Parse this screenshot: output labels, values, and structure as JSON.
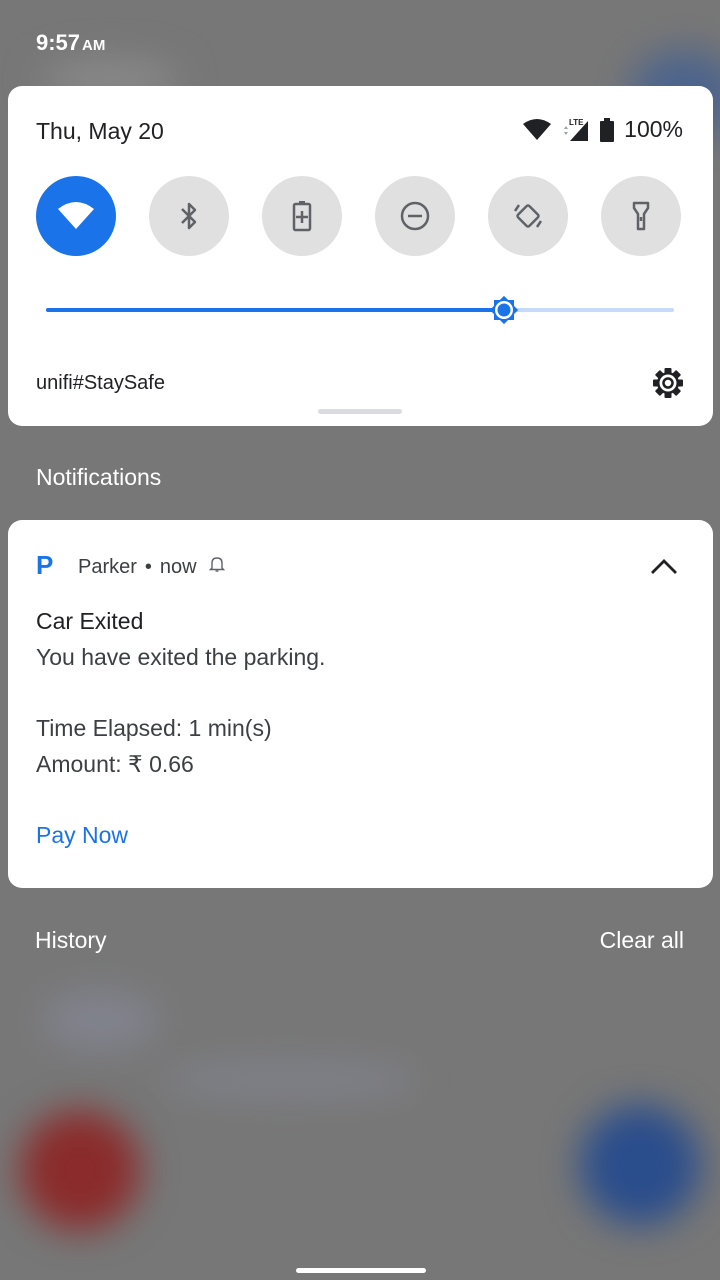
{
  "status_bar": {
    "time": "9:57",
    "ampm": "AM"
  },
  "quick_settings": {
    "date": "Thu, May 20",
    "battery_text": "100%",
    "tiles": [
      {
        "name": "wifi",
        "icon": "wifi-icon",
        "on": true
      },
      {
        "name": "bluetooth",
        "icon": "bluetooth-icon",
        "on": false
      },
      {
        "name": "battery-saver",
        "icon": "battery-saver-icon",
        "on": false
      },
      {
        "name": "do-not-disturb",
        "icon": "do-not-disturb-icon",
        "on": false
      },
      {
        "name": "auto-rotate",
        "icon": "auto-rotate-icon",
        "on": false
      },
      {
        "name": "flashlight",
        "icon": "flashlight-icon",
        "on": false
      }
    ],
    "brightness_level": 0.73,
    "network_name": "unifi#StaySafe",
    "accent_color": "#1a73e8"
  },
  "notifications_label": "Notifications",
  "notification": {
    "app_icon_letter": "P",
    "app_name": "Parker",
    "separator": "•",
    "time": "now",
    "title": "Car Exited",
    "line1": "You have exited the parking.",
    "line2": "Time Elapsed: 1 min(s)",
    "line3": "Amount: ₹ 0.66",
    "action_label": "Pay Now"
  },
  "history": {
    "label": "History",
    "clear_all": "Clear all"
  }
}
